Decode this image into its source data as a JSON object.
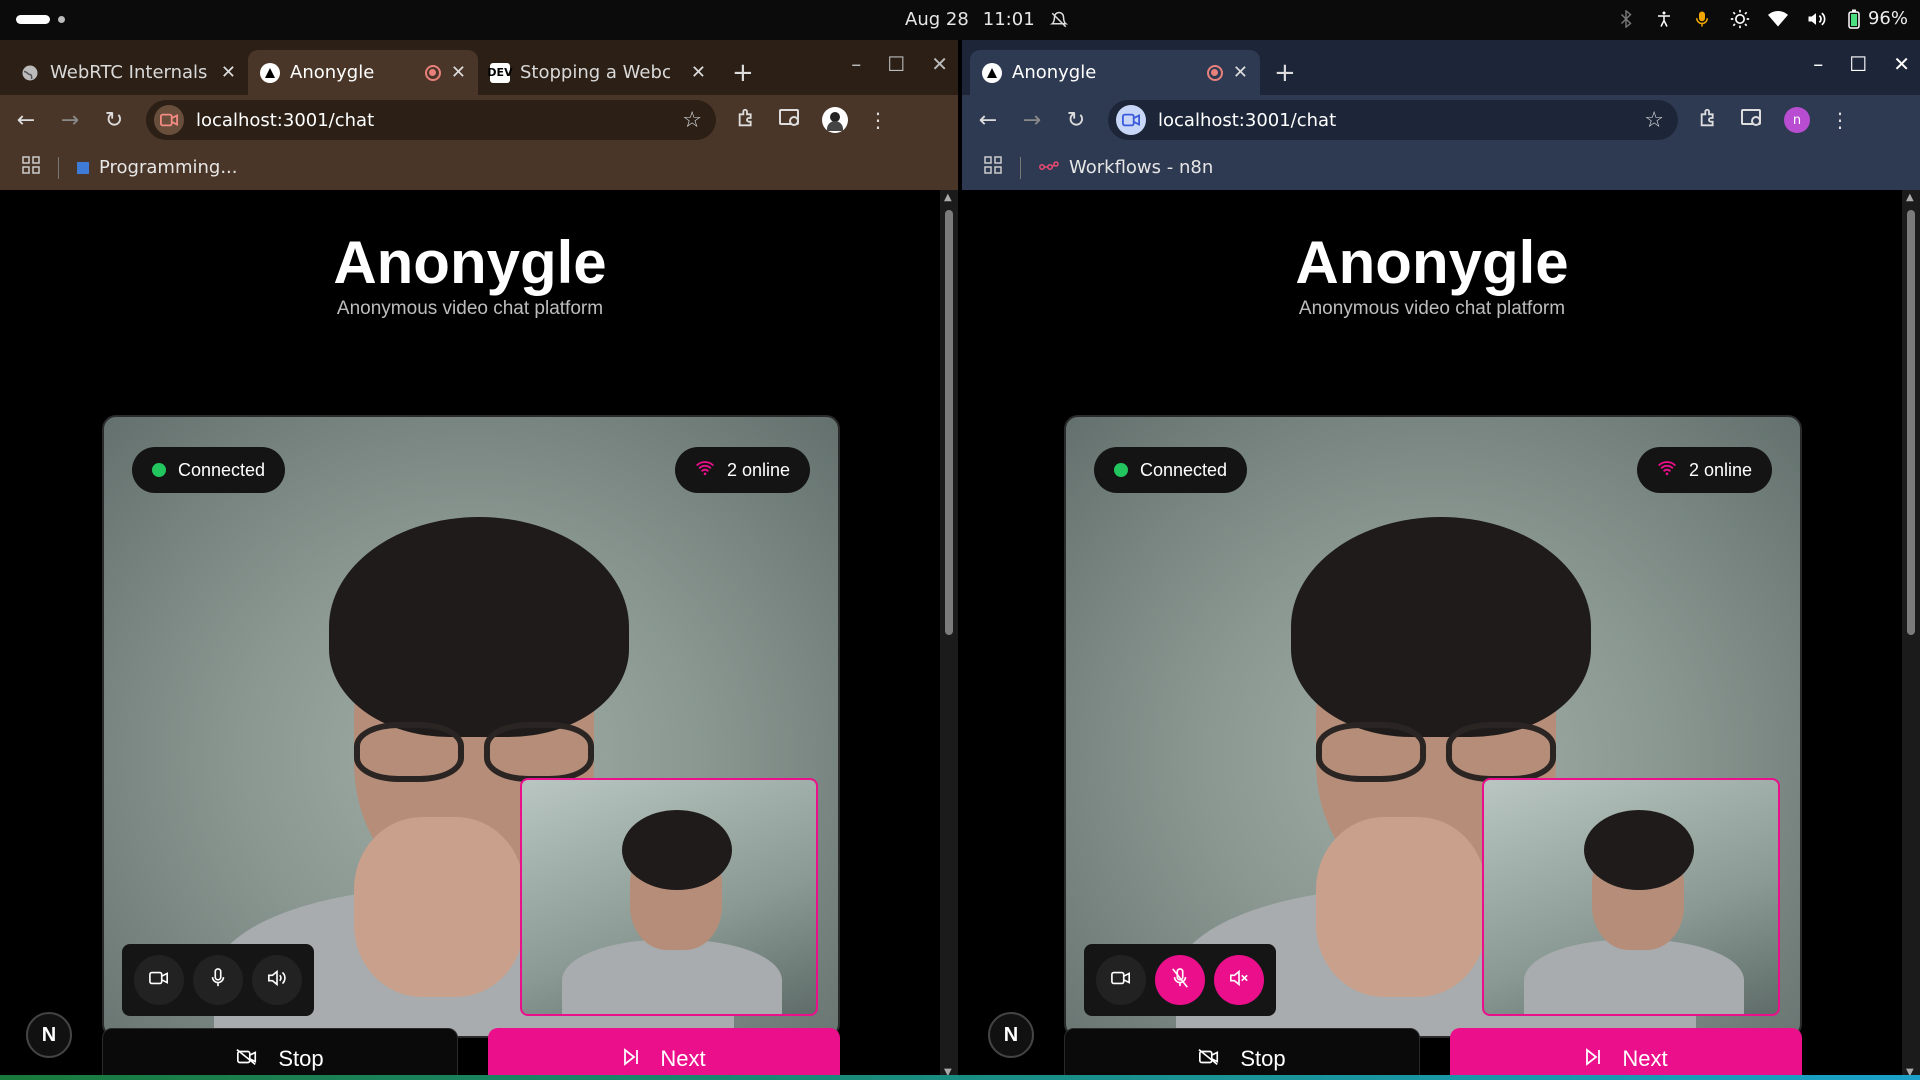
{
  "system": {
    "date": "Aug 28",
    "time": "11:01",
    "battery": "96%"
  },
  "left_window": {
    "tabs": [
      {
        "title": "WebRTC Internals",
        "favicon": "globe-icon"
      },
      {
        "title": "Anonygle",
        "favicon": "triangle-logo-icon",
        "recording": true
      },
      {
        "title": "Stopping a Webca",
        "favicon": "dev-icon"
      }
    ],
    "url": "localhost:3001/chat",
    "bookmark": "Programming..."
  },
  "right_window": {
    "tabs": [
      {
        "title": "Anonygle",
        "favicon": "triangle-logo-icon",
        "recording": true
      }
    ],
    "url": "localhost:3001/chat",
    "bookmark": "Workflows - n8n",
    "profile_initial": "n"
  },
  "app": {
    "title": "Anonygle",
    "subtitle": "Anonymous video chat platform",
    "status": "Connected",
    "online": "2 online",
    "stop_label": "Stop",
    "next_label": "Next",
    "n_badge": "N"
  },
  "colors": {
    "accent": "#ec0f8c",
    "connected": "#22c55e"
  }
}
